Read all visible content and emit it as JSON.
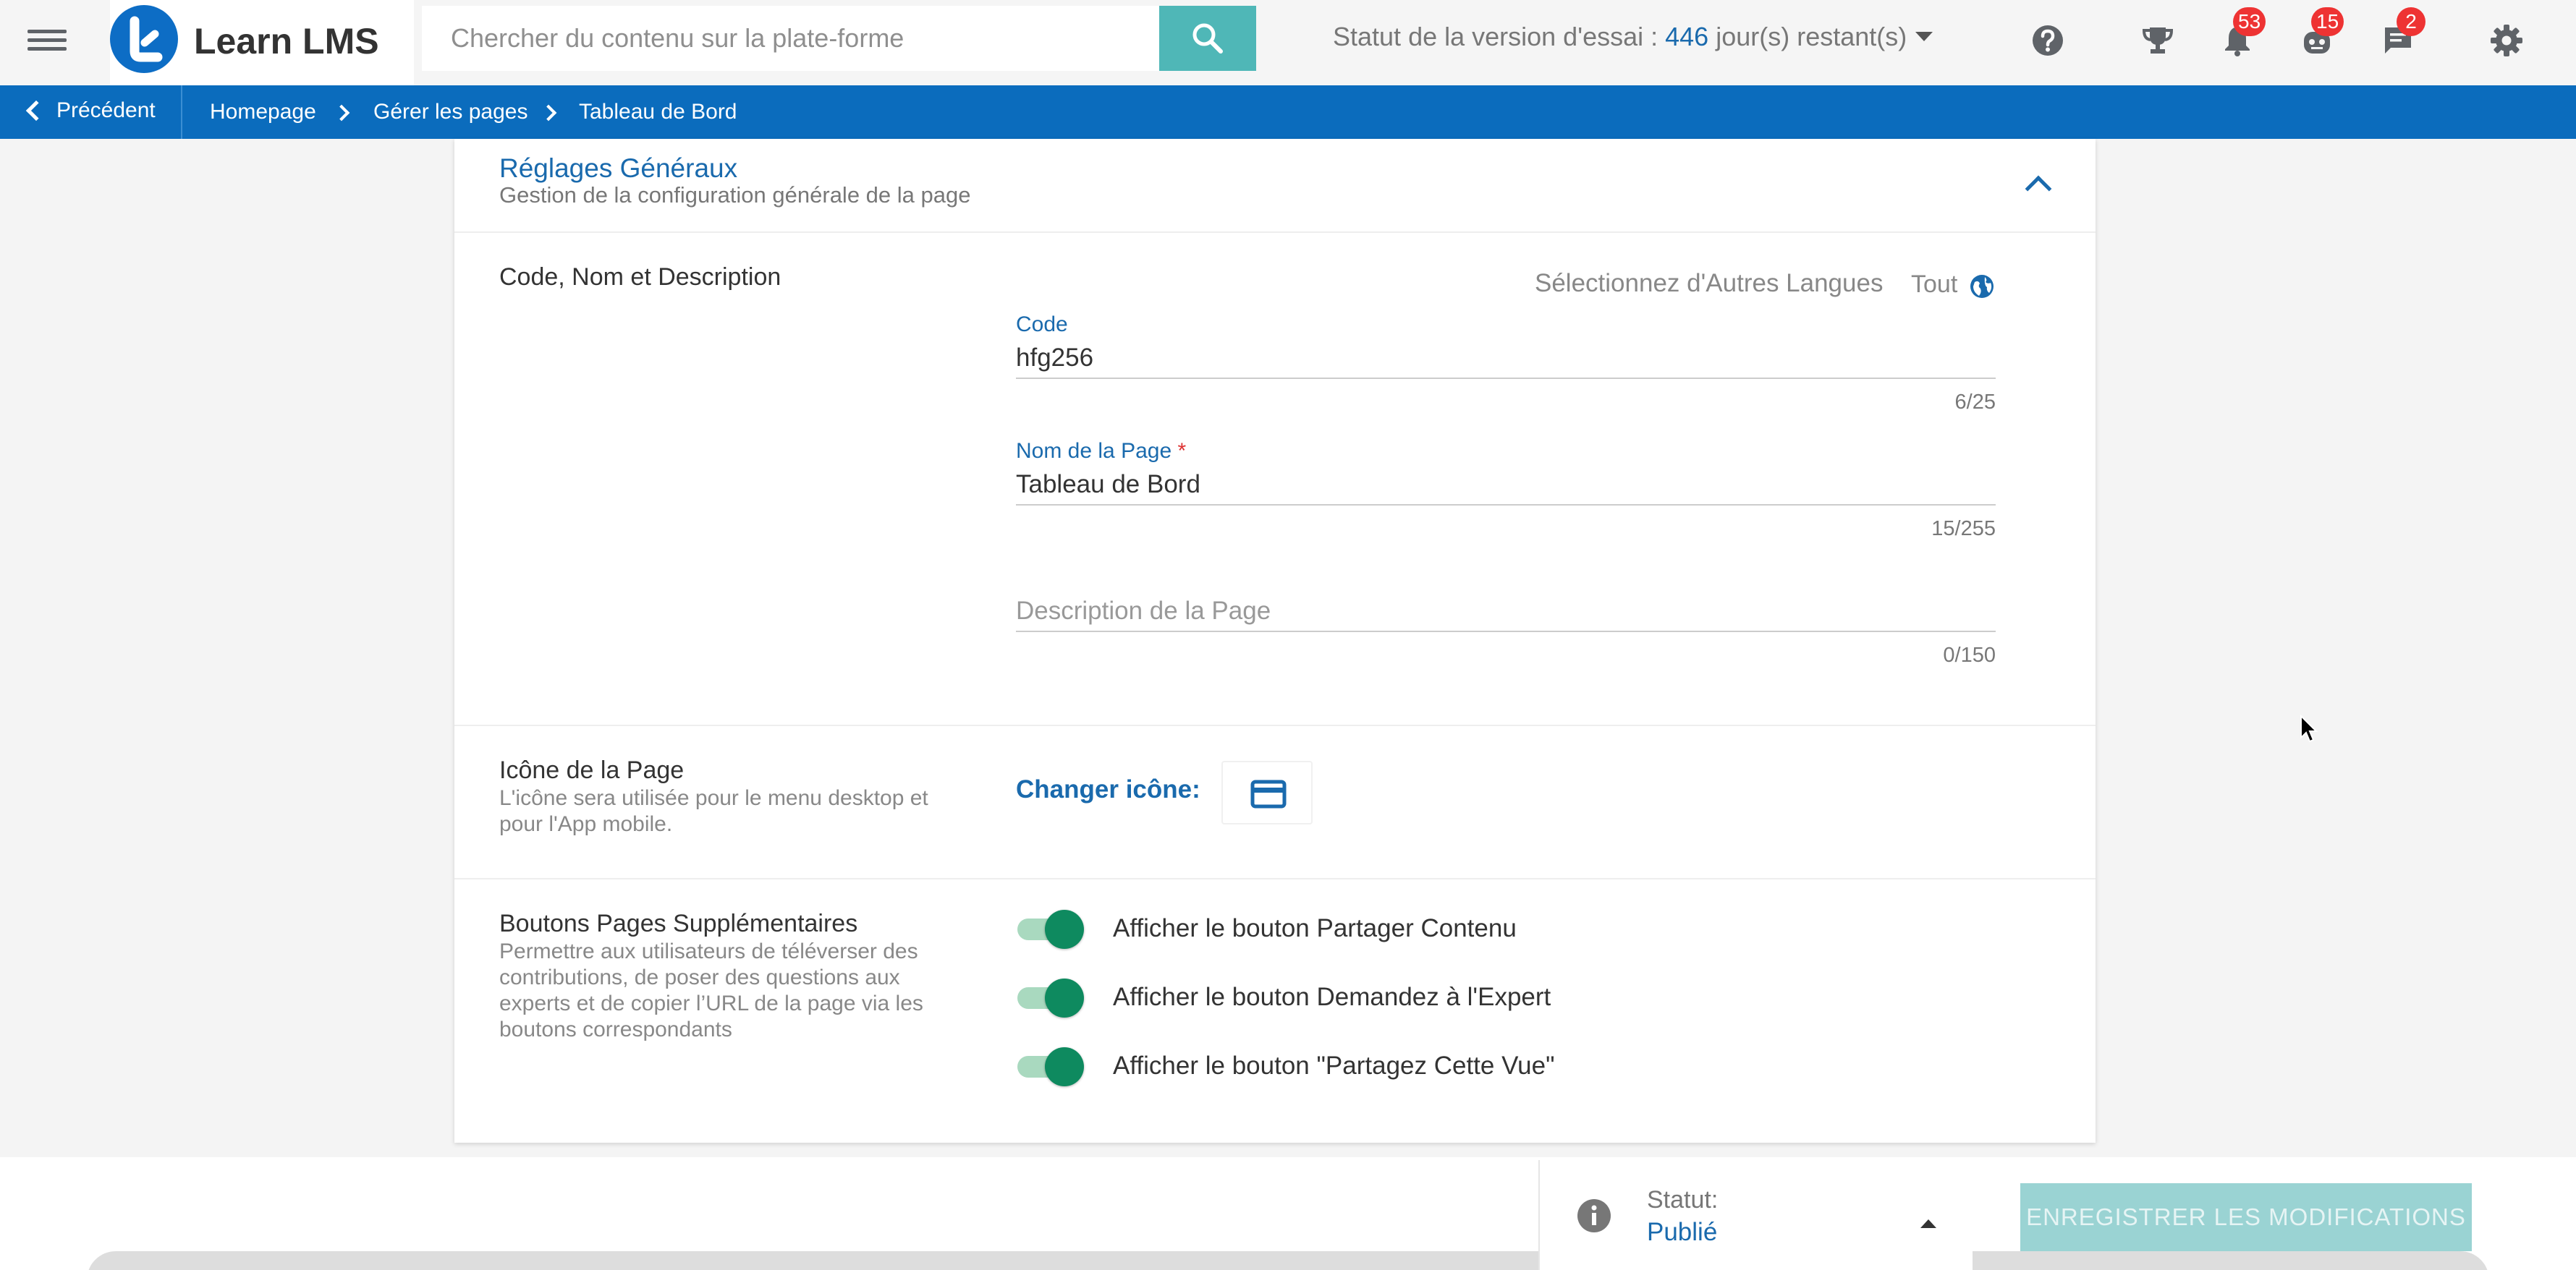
{
  "topbar": {
    "brand_name": "Learn LMS",
    "search_placeholder": "Chercher du contenu sur la plate-forme",
    "trial_prefix": "Statut de la version d'essai : ",
    "trial_days": "446",
    "trial_suffix": " jour(s) restant(s)",
    "badges": {
      "notifications": "53",
      "bot": "15",
      "messages": "2"
    },
    "icons": [
      "menu-icon",
      "search-icon",
      "help-icon",
      "trophy-icon",
      "bell-icon",
      "bot-icon",
      "chat-icon",
      "gear-icon"
    ]
  },
  "breadcrumb": {
    "back_label": "Précédent",
    "items": [
      "Homepage",
      "Gérer les pages",
      "Tableau de Bord"
    ]
  },
  "general": {
    "title": "Réglages Généraux",
    "subtitle": "Gestion de la configuration générale de la page"
  },
  "code_section": {
    "title": "Code, Nom et Description",
    "lang_select": "Sélectionnez d'Autres Langues",
    "lang_all": "Tout",
    "code_label": "Code",
    "code_value": "hfg256",
    "code_count": "6/25",
    "name_label": "Nom de la Page",
    "name_required": "*",
    "name_value": "Tableau de Bord",
    "name_count": "15/255",
    "desc_placeholder": "Description de la Page",
    "desc_count": "0/150"
  },
  "icon_section": {
    "title": "Icône de la Page",
    "desc": "L'icône sera utilisée pour le menu desktop et pour l'App mobile.",
    "change_label": "Changer icône:"
  },
  "buttons_section": {
    "title": "Boutons Pages Supplémentaires",
    "desc": "Permettre aux utilisateurs de téléverser des contributions, de poser des questions aux experts et de copier l’URL de la page via les boutons correspondants",
    "toggles": [
      {
        "label": "Afficher le bouton Partager Contenu",
        "on": true
      },
      {
        "label": "Afficher le bouton Demandez à l'Expert",
        "on": true
      },
      {
        "label": "Afficher le bouton \"Partagez Cette Vue\"",
        "on": true
      }
    ]
  },
  "footer": {
    "status_label": "Statut:",
    "status_value": "Publié",
    "save_label": "ENREGISTRER LES MODIFICATIONS"
  },
  "colors": {
    "accent": "#0b6cbd",
    "search_button": "#4fb7b7",
    "toggle_on": "#0e8a5f",
    "badge": "#e33333",
    "save_disabled": "#9ad3d3"
  }
}
